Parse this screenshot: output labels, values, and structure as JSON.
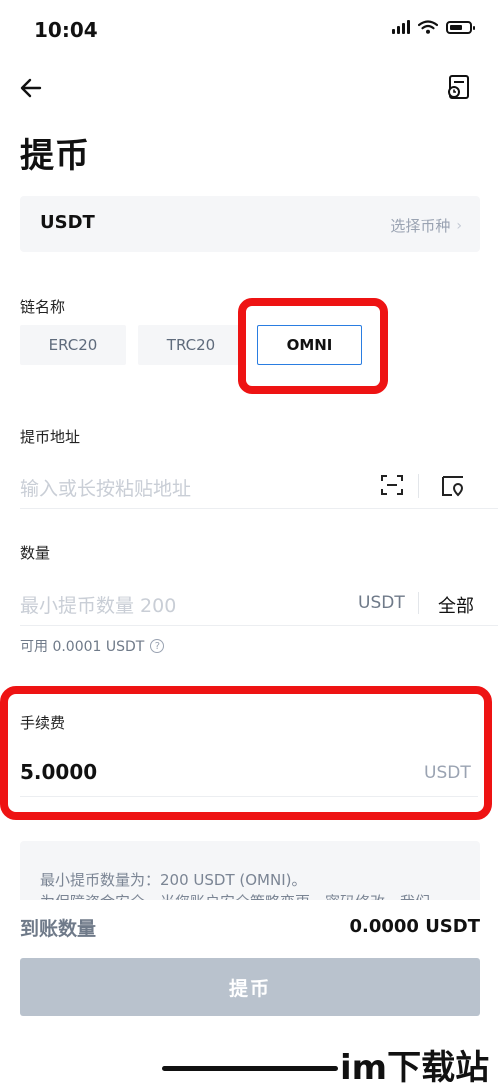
{
  "status_bar": {
    "time": "10:04"
  },
  "header": {
    "title": "提币"
  },
  "coin": {
    "name": "USDT",
    "choose_label": "选择币种"
  },
  "chain": {
    "label": "链名称",
    "options": [
      "ERC20",
      "TRC20",
      "OMNI"
    ],
    "selected": "OMNI",
    "accent_color": "#2a7de1"
  },
  "address": {
    "label": "提币地址",
    "placeholder": "输入或长按粘贴地址"
  },
  "amount": {
    "label": "数量",
    "placeholder": "最小提币数量 200",
    "unit": "USDT",
    "all_label": "全部",
    "available": "可用 0.0001 USDT"
  },
  "fee": {
    "label": "手续费",
    "value": "5.0000",
    "unit": "USDT"
  },
  "notice": {
    "line1": "最小提币数量为：200 USDT (OMNI)。",
    "line2": "为保障资金安全，当您账户安全策略变更、密码修改、我们"
  },
  "summary": {
    "arrive_label": "到账数量",
    "arrive_value": "0.0000 USDT"
  },
  "submit": {
    "label": "提币"
  },
  "watermark": {
    "text": "im下载站"
  },
  "colors": {
    "highlight_red": "#ee1313",
    "disabled_button": "#b9c2cd"
  }
}
